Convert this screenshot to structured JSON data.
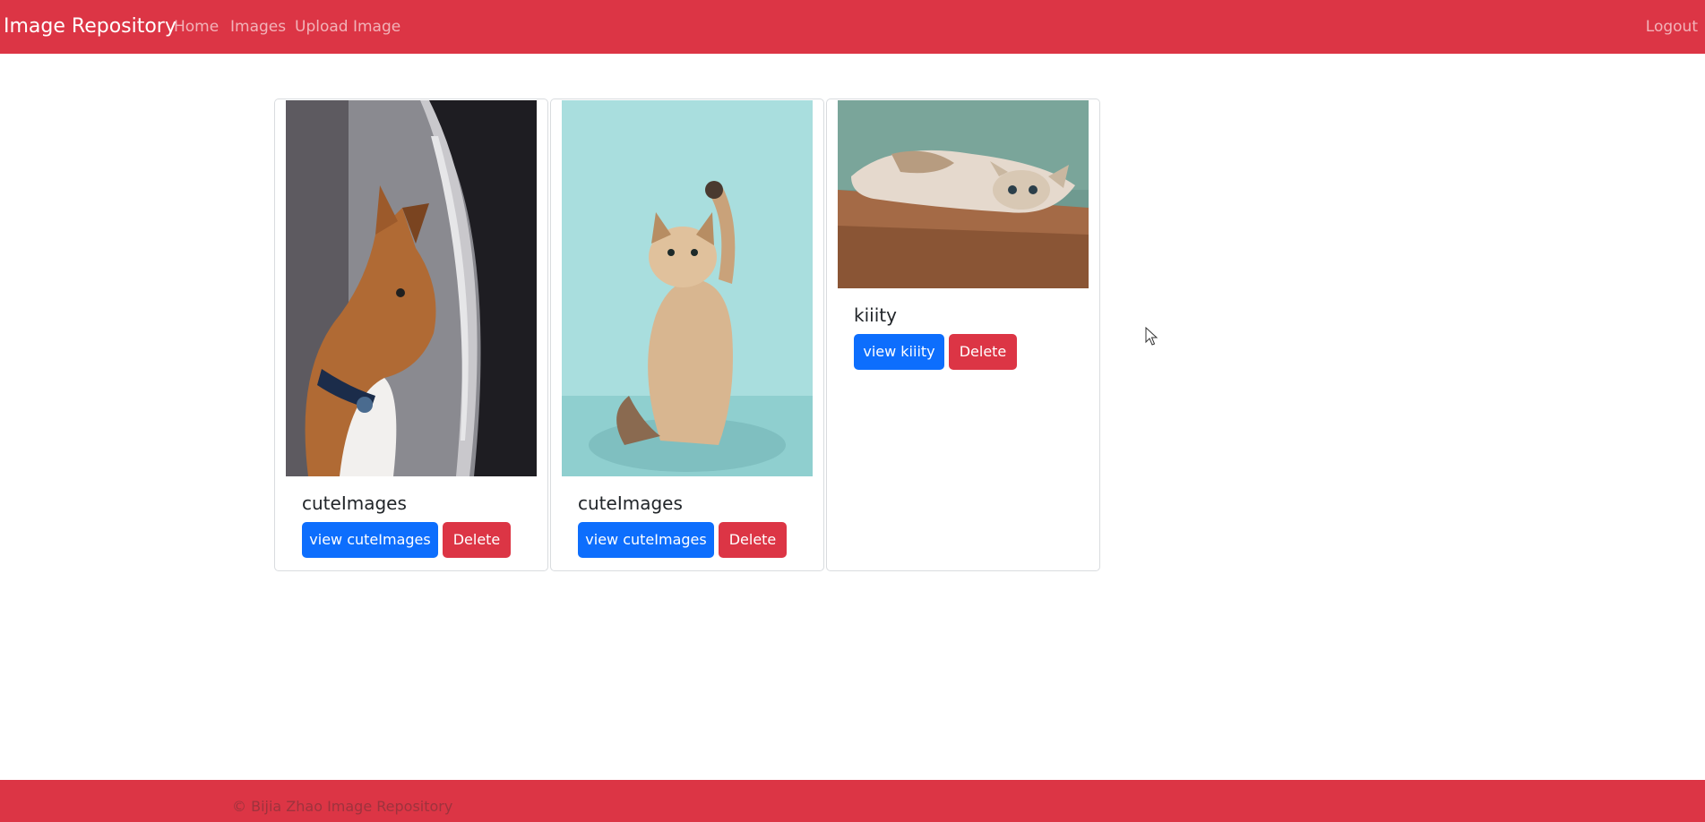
{
  "navbar": {
    "brand": "Image Repository",
    "links": [
      {
        "label": "Home"
      },
      {
        "label": "Images"
      },
      {
        "label": "Upload Image"
      }
    ],
    "logout": "Logout",
    "color": "#dc3545"
  },
  "cards": [
    {
      "title": "cuteImages",
      "image": "cat-by-window",
      "view_label": "view cuteImages",
      "delete_label": "Delete"
    },
    {
      "title": "cuteImages",
      "image": "kitten-raising-paw",
      "view_label": "view cuteImages",
      "delete_label": "Delete"
    },
    {
      "title": "kiiity",
      "image": "cat-lying-on-floor",
      "view_label": "view kiiity",
      "delete_label": "Delete"
    }
  ],
  "colors": {
    "primary": "#0d6efd",
    "danger": "#dc3545"
  },
  "footer": {
    "text": "© Bijia Zhao Image Repository"
  }
}
